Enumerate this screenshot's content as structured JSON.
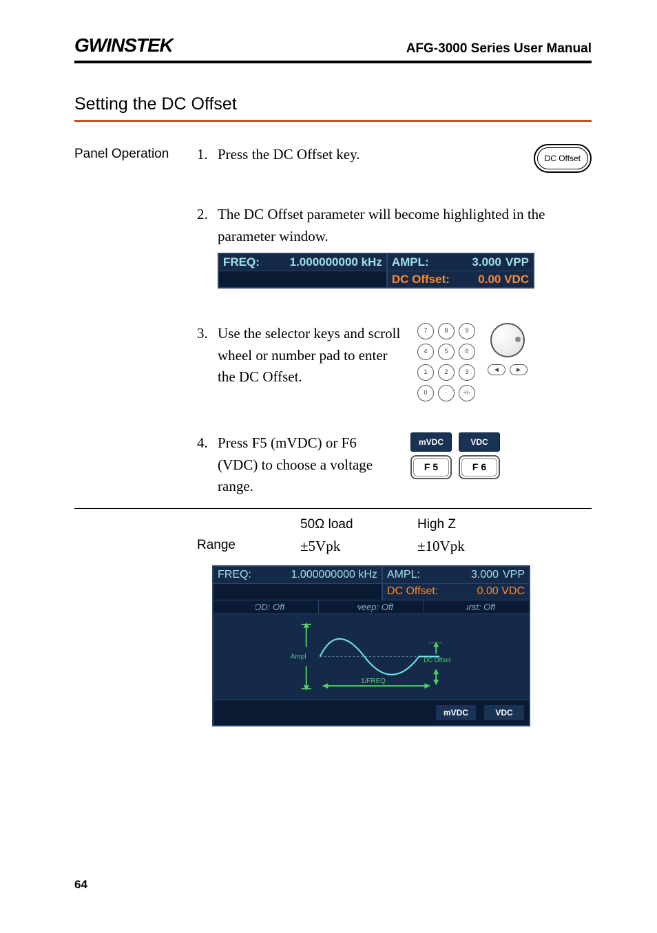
{
  "header": {
    "logo": "GWINSTEK",
    "manual_title": "AFG-3000 Series User Manual"
  },
  "section_title": "Setting the DC Offset",
  "panel_operation_label": "Panel Operation",
  "steps": {
    "s1": {
      "num": "1.",
      "text": "Press the DC Offset key.",
      "button_label": "DC Offset"
    },
    "s2": {
      "num": "2.",
      "text": "The DC Offset parameter will become highlighted in the parameter window."
    },
    "s3": {
      "num": "3.",
      "text": "Use the selector keys and scroll wheel or number pad to enter the DC Offset."
    },
    "s4": {
      "num": "4.",
      "text": "Press F5 (mVDC) or F6 (VDC) to choose a voltage range."
    }
  },
  "lcd_small": {
    "freq_label": "FREQ:",
    "freq_value": "1.000000000 kHz",
    "ampl_label": "AMPL:",
    "ampl_value": "3.000",
    "ampl_unit": "VPP",
    "dcoffset_label": "DC Offset:",
    "dcoffset_value": "0.00 VDC"
  },
  "keypad_keys": [
    "7",
    "8",
    "9",
    "4",
    "5",
    "6",
    "1",
    "2",
    "3",
    "0",
    "·",
    "+/-"
  ],
  "fbuttons": {
    "mvdc": "mVDC",
    "vdc": "VDC",
    "f5": "F 5",
    "f6": "F 6"
  },
  "range_table": {
    "header": {
      "col1": "",
      "col2": "50Ω load",
      "col3": "High Z"
    },
    "row": {
      "col1": "Range",
      "col2": "±5Vpk",
      "col3": "±10Vpk"
    }
  },
  "full_lcd": {
    "freq_label": "FREQ:",
    "freq_value": "1.000000000 kHz",
    "ampl_label": "AMPL:",
    "ampl_value": "3.000",
    "ampl_unit": "VPP",
    "dcoffset_label": "DC Offset:",
    "dcoffset_value": "0.00 VDC",
    "tabs": {
      "mod": "MOD: Off",
      "sweep": "Sweep: Off",
      "burst": "Burst: Off"
    },
    "wave": {
      "ampl_label": "Ampl",
      "freq_label": "1/FREQ",
      "dcoffset_label": "DC Offset"
    },
    "bottom": {
      "mvdc": "mVDC",
      "vdc": "VDC"
    }
  },
  "page_number": "64"
}
